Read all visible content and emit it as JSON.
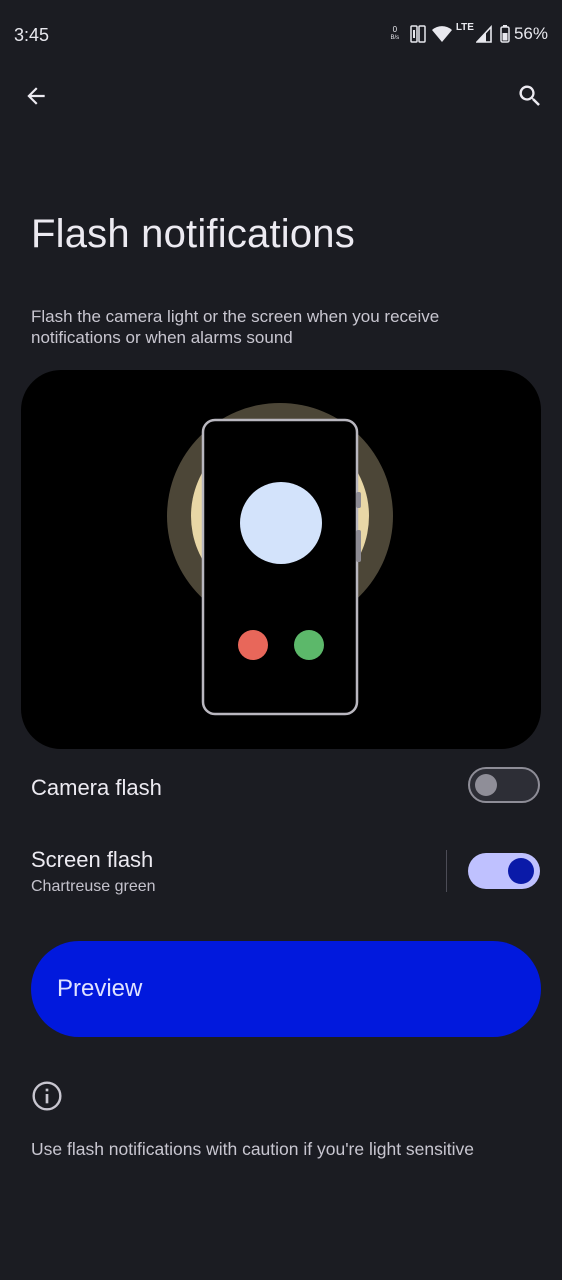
{
  "status_bar": {
    "time": "3:45",
    "net_speed_value": "0",
    "net_speed_unit": "B/s",
    "network_type": "LTE",
    "battery_percent": "56%"
  },
  "top_bar": {
    "back_icon": "arrow-back-icon",
    "search_icon": "search-icon"
  },
  "page": {
    "title": "Flash notifications",
    "description": "Flash the camera light or the screen when you receive notifications or when alarms sound"
  },
  "settings": {
    "camera_flash": {
      "label": "Camera flash",
      "enabled": false
    },
    "screen_flash": {
      "label": "Screen flash",
      "color_name": "Chartreuse green",
      "enabled": true
    }
  },
  "preview_button": {
    "label": "Preview"
  },
  "footer": {
    "info_icon": "info-icon",
    "text": "Use flash notifications with caution if you're light sensitive"
  },
  "colors": {
    "background": "#1b1c22",
    "accent": "#0119dd",
    "toggle_on_track": "#bfc1ff",
    "toggle_on_knob": "#0a1aa8",
    "decline_dot": "#e8675a",
    "accept_dot": "#5cb86a"
  }
}
